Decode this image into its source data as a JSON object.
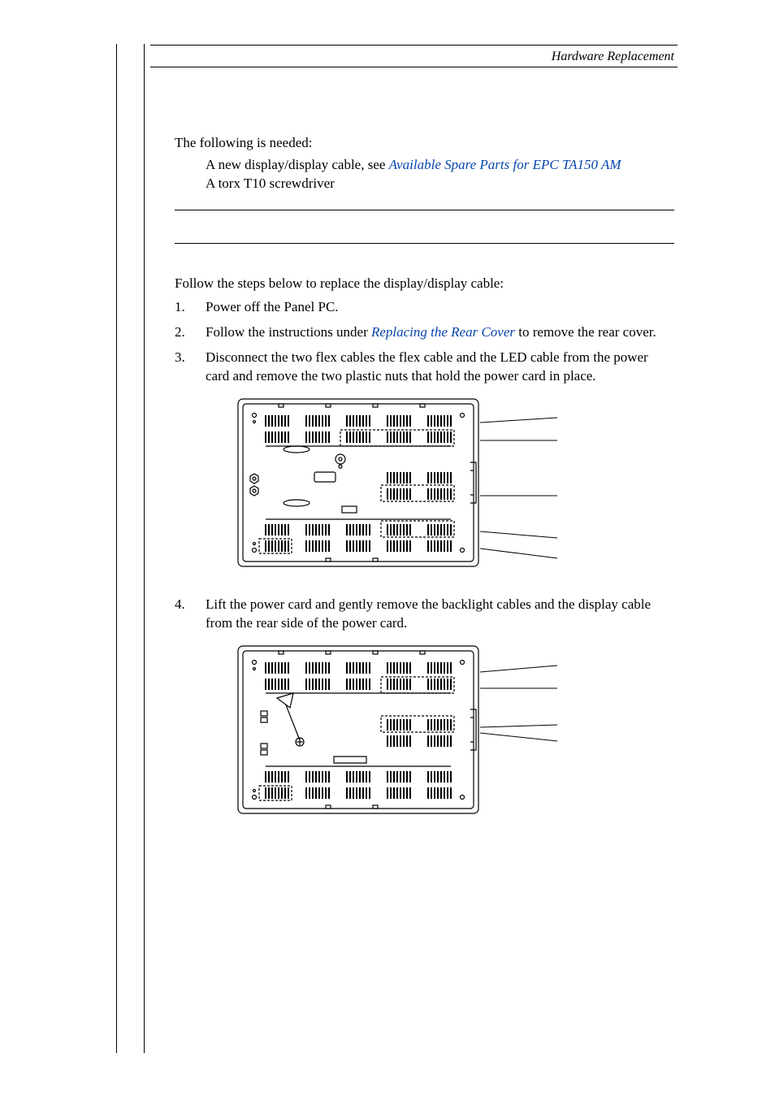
{
  "header": {
    "title": "Hardware Replacement"
  },
  "intro": {
    "needed": "The following is needed:",
    "spare_line_prefix": "A new display/display cable, see ",
    "spare_link": "Available Spare Parts for EPC TA150 AM",
    "screwdriver": "A torx T10 screwdriver"
  },
  "instructions": {
    "lead": "Follow the steps below to replace the display/display cable:",
    "steps": [
      {
        "text": "Power off the Panel PC."
      },
      {
        "prefix": "Follow the instructions under ",
        "link": "Replacing the Rear Cover",
        "suffix": " to remove the rear cover."
      },
      {
        "text": "Disconnect the two flex cables the flex cable and the LED cable from the power card and remove the two plastic nuts that hold the power card in place."
      },
      {
        "text": "Lift the power card and gently remove the backlight cables and the display cable from the rear side of the power card."
      }
    ]
  }
}
